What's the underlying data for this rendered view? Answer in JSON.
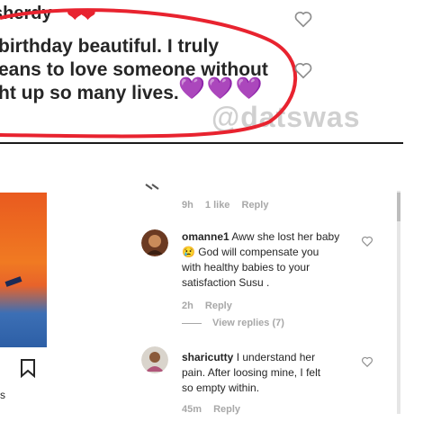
{
  "top_post": {
    "username": "sherdy",
    "hearts": "❤❤",
    "lines": [
      "birthday beautiful. I truly",
      "eans to love someone without",
      "ht up so many lives."
    ],
    "emoji": "💜💜💜",
    "watermark": "@datswas"
  },
  "comments": [
    {
      "meta_time": "9h",
      "meta_likes": "1 like",
      "meta_reply": "Reply"
    },
    {
      "username": "omanne1",
      "text_lines": [
        "Aww she lost her baby",
        "😢 God will compensate you",
        "with healthy babies to your",
        "satisfaction Susu ."
      ],
      "meta_time": "2h",
      "meta_reply": "Reply",
      "view_replies": "View replies (7)"
    },
    {
      "username": "sharicutty",
      "text_lines": [
        "I understand her",
        "pain. After loosing mine, I felt",
        "so empty within."
      ],
      "meta_time": "45m",
      "meta_reply": "Reply"
    }
  ],
  "left": {
    "bottom_char": "s"
  },
  "colors": {
    "accent_red": "#e8232f",
    "purple": "#8a3fd1",
    "meta_gray": "#a8a8a8"
  }
}
